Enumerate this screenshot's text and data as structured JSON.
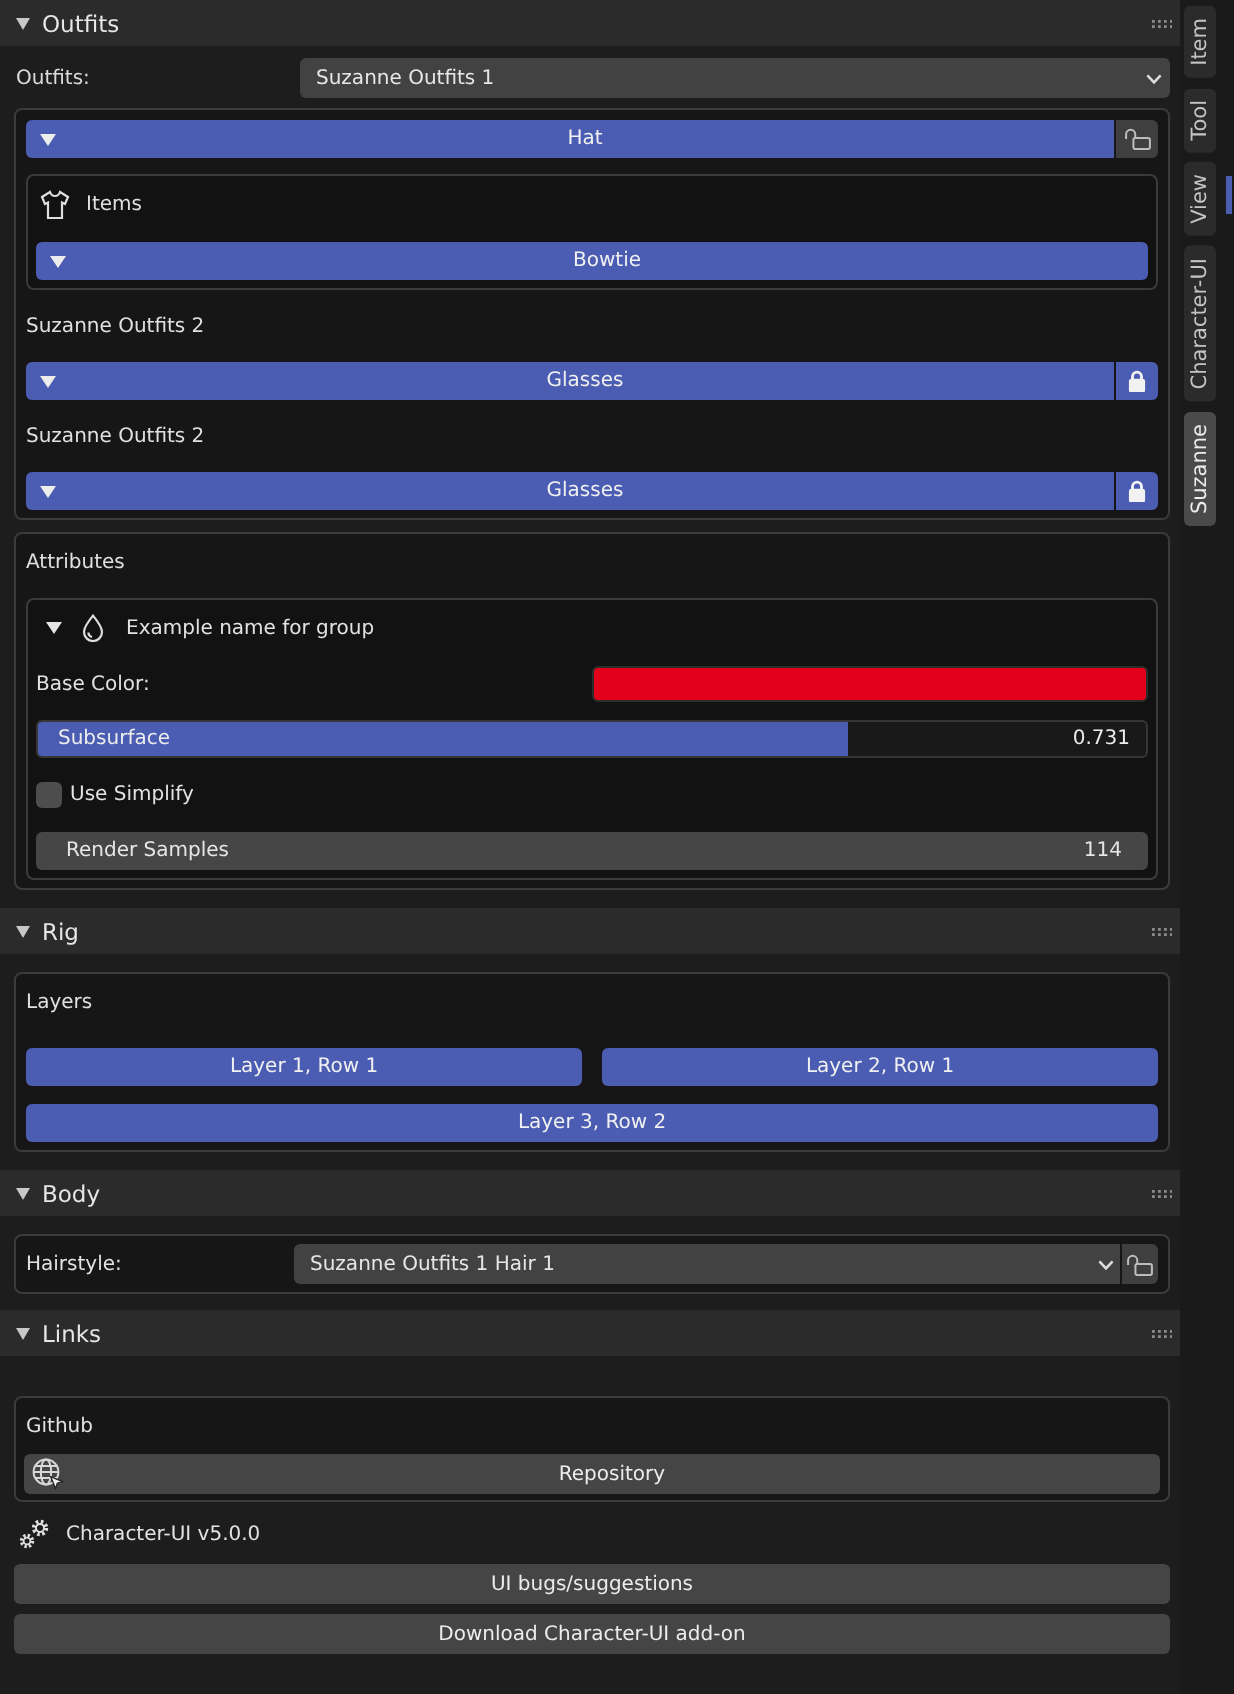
{
  "panels": [
    {
      "kind": "outfits",
      "title": "Outfits",
      "expanded": true,
      "outfit_select": {
        "label": "Outfits:",
        "value": "Suzanne Outfits 1"
      },
      "outfit_box": {
        "pieces": [
          {
            "label": "Hat",
            "expanded": true,
            "on": true,
            "locked": false,
            "items": {
              "title": "Items",
              "pieces": [
                {
                  "label": "Bowtie",
                  "expanded": true,
                  "on": true
                }
              ]
            }
          }
        ],
        "collections": [
          {
            "title": "Suzanne Outfits 2",
            "pieces": [
              {
                "label": "Glasses",
                "expanded": true,
                "on": true,
                "locked": true
              }
            ]
          },
          {
            "title": "Suzanne Outfits 2",
            "pieces": [
              {
                "label": "Glasses",
                "expanded": true,
                "on": true,
                "locked": true
              }
            ]
          }
        ]
      },
      "attributes_box": {
        "title": "Attributes",
        "groups": [
          {
            "title": "Example name for group",
            "expanded": true,
            "properties": [
              {
                "kind": "color",
                "label": "Base Color:",
                "color": "#e3001b"
              },
              {
                "kind": "slider",
                "label": "Subsurface",
                "value": "0.731",
                "level": 0.731
              },
              {
                "kind": "checkbox",
                "label": "Use Simplify",
                "checked": false
              },
              {
                "kind": "number",
                "label": "Render Samples",
                "value": "114"
              }
            ]
          }
        ]
      }
    },
    {
      "kind": "rig",
      "title": "Rig",
      "expanded": true,
      "layers_box": {
        "title": "Layers",
        "rows": [
          {
            "buttons": [
              {
                "label": "Layer 1, Row 1",
                "on": true
              },
              {
                "label": "Layer 2, Row 1",
                "on": true
              }
            ]
          },
          {
            "buttons": [
              {
                "label": "Layer 3, Row 2",
                "on": true
              }
            ]
          }
        ]
      }
    },
    {
      "kind": "body",
      "title": "Body",
      "expanded": true,
      "hairstyle": {
        "label": "Hairstyle:",
        "value": "Suzanne Outfits 1 Hair 1",
        "locked": false
      }
    },
    {
      "kind": "links",
      "title": "Links",
      "expanded": true,
      "github_box": {
        "title": "Github",
        "button": "Repository"
      },
      "version": "Character-UI v5.0.0",
      "buttons": [
        "UI bugs/suggestions",
        "Download Character-UI add-on"
      ]
    }
  ],
  "sidebar_tabs": [
    {
      "label": "Item",
      "selected": false
    },
    {
      "label": "Tool",
      "selected": false
    },
    {
      "label": "View",
      "selected": false
    },
    {
      "label": "Character-UI",
      "selected": false
    },
    {
      "label": "Suzanne",
      "selected": true
    }
  ]
}
